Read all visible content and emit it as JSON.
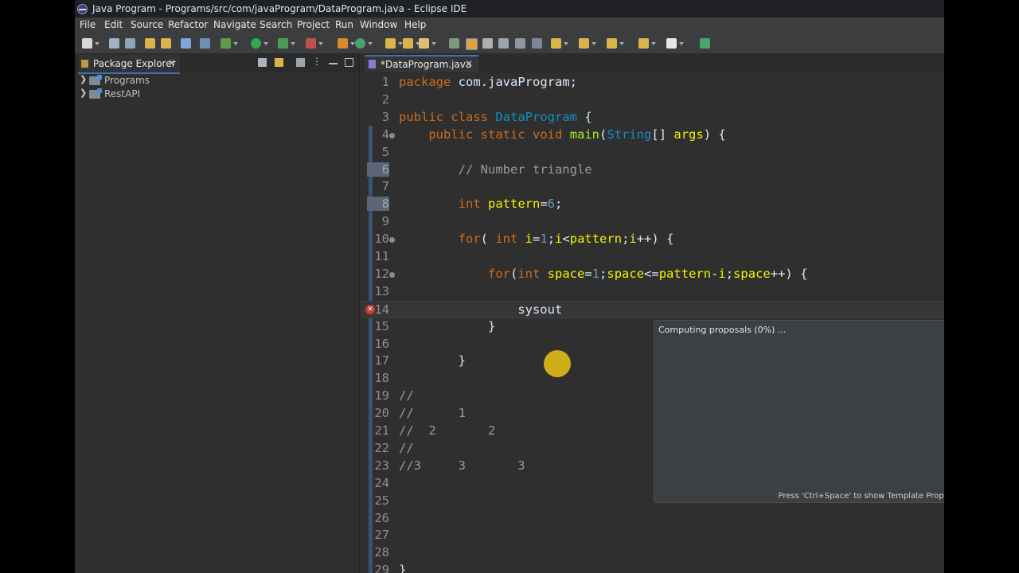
{
  "window": {
    "title": "Java Program - Programs/src/com/javaProgram/DataProgram.java - Eclipse IDE"
  },
  "menu": [
    "File",
    "Edit",
    "Source",
    "Refactor",
    "Navigate",
    "Search",
    "Project",
    "Run",
    "Window",
    "Help"
  ],
  "package_explorer": {
    "tab_label": "Package Explorer",
    "items": [
      {
        "label": "Programs"
      },
      {
        "label": "RestAPI"
      }
    ]
  },
  "editor": {
    "tab_label": "*DataProgram.java",
    "lines": [
      {
        "n": "1",
        "code": "package com.javaProgram;"
      },
      {
        "n": "2",
        "code": ""
      },
      {
        "n": "3",
        "code": "public class DataProgram {"
      },
      {
        "n": "4",
        "code": "    public static void main(String[] args) {"
      },
      {
        "n": "5",
        "code": ""
      },
      {
        "n": "6",
        "code": "        // Number triangle"
      },
      {
        "n": "7",
        "code": ""
      },
      {
        "n": "8",
        "code": "        int pattern=6;"
      },
      {
        "n": "9",
        "code": ""
      },
      {
        "n": "10",
        "code": "        for( int i=1;i<pattern;i++) {"
      },
      {
        "n": "11",
        "code": ""
      },
      {
        "n": "12",
        "code": "            for(int space=1;space<=pattern-i;space++) {"
      },
      {
        "n": "13",
        "code": ""
      },
      {
        "n": "14",
        "code": "                sysout"
      },
      {
        "n": "15",
        "code": "            }"
      },
      {
        "n": "16",
        "code": ""
      },
      {
        "n": "17",
        "code": "        }"
      },
      {
        "n": "18",
        "code": ""
      },
      {
        "n": "19",
        "code": "//"
      },
      {
        "n": "20",
        "code": "//      1"
      },
      {
        "n": "21",
        "code": "//  2       2"
      },
      {
        "n": "22",
        "code": "//"
      },
      {
        "n": "23",
        "code": "//3     3       3"
      },
      {
        "n": "24",
        "code": ""
      },
      {
        "n": "25",
        "code": ""
      },
      {
        "n": "26",
        "code": ""
      },
      {
        "n": "27",
        "code": ""
      },
      {
        "n": "28",
        "code": ""
      },
      {
        "n": "29",
        "code": "}"
      }
    ]
  },
  "proposals_popup": {
    "status": "Computing proposals (0%) ...",
    "footer": "Press 'Ctrl+Space' to show Template Proposals"
  }
}
